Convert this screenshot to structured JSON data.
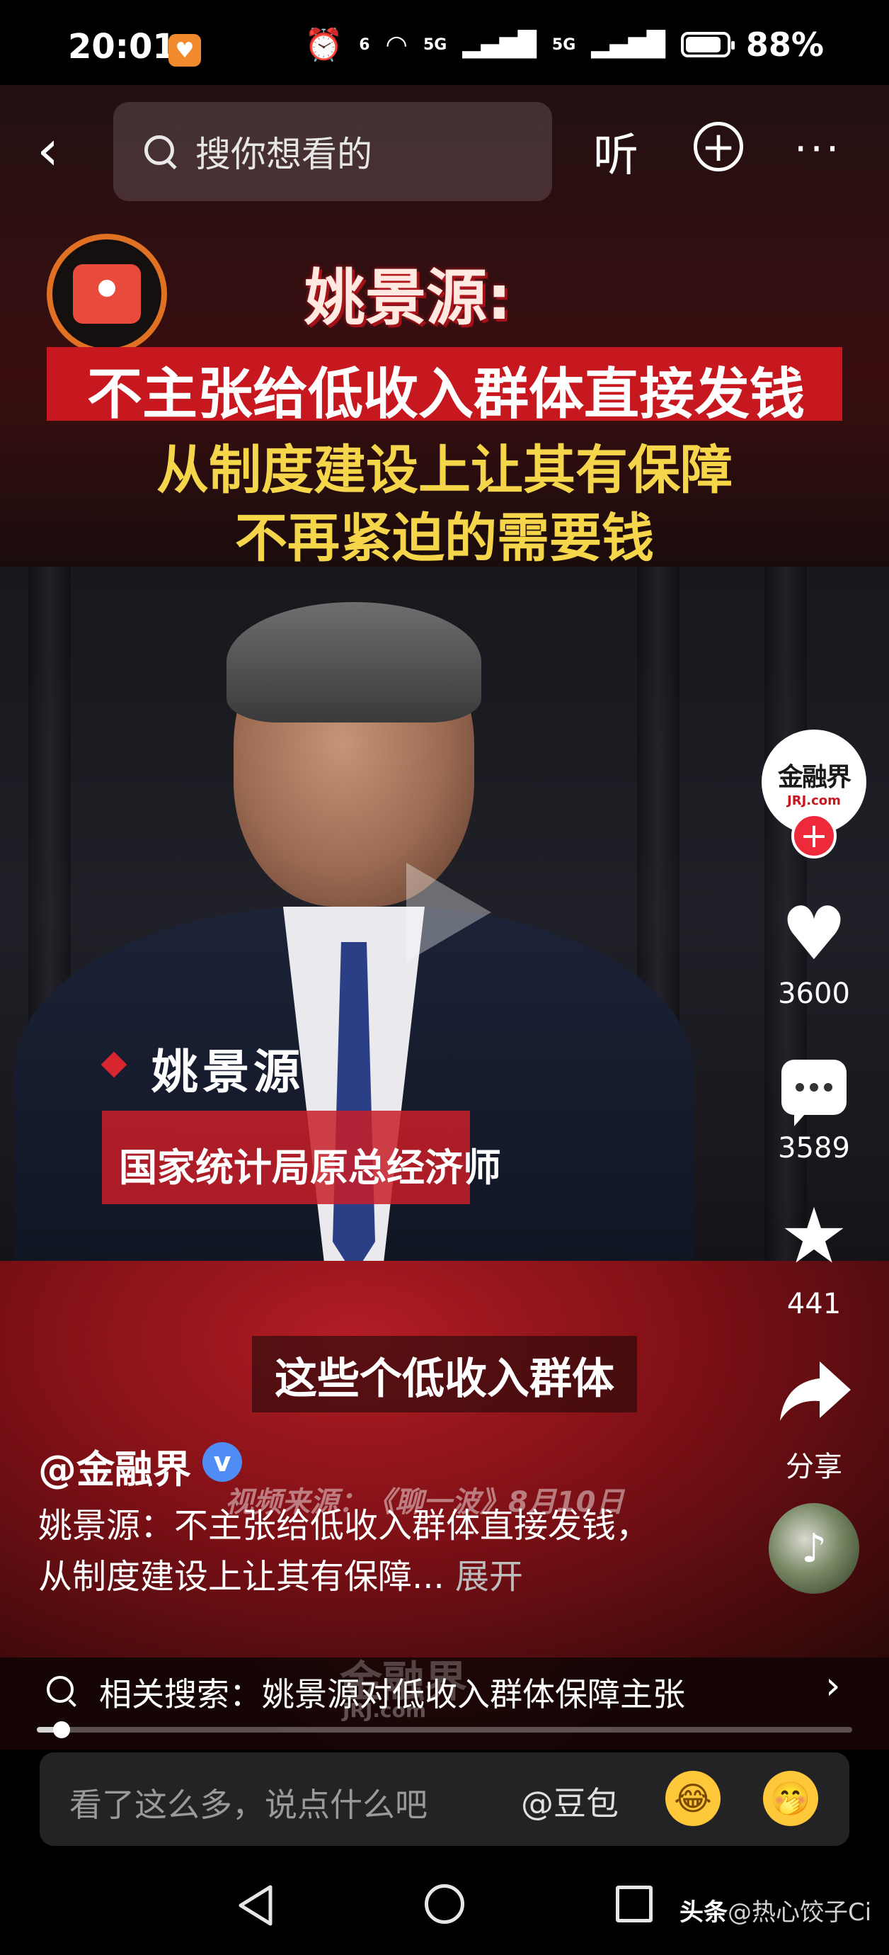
{
  "status_bar": {
    "time": "20:01",
    "signal_label_1": "5G",
    "signal_label_2": "5G",
    "wifi_label": "6",
    "battery_percent": "88%",
    "battery_level": 0.88
  },
  "top_bar": {
    "search_placeholder": "搜你想看的",
    "listen_label": "听"
  },
  "headline": {
    "name": "姚景源:",
    "line1": "不主张给低收入群体直接发钱",
    "line2": "从制度建设上让其有保障",
    "line3": "不再紧迫的需要钱"
  },
  "lower_third": {
    "speaker_name": "姚景源",
    "speaker_title": "国家统计局原总经济师"
  },
  "subtitle": "这些个低收入群体",
  "actions": {
    "author_avatar_text": "金融界",
    "author_avatar_sub": "JRJ.com",
    "like_count": "3600",
    "comment_count": "3589",
    "favorite_count": "441",
    "share_label": "分享"
  },
  "post": {
    "author_handle": "@金融界",
    "video_source": "视频来源：《聊一波》8月10日",
    "caption": "姚景源：不主张给低收入群体直接发钱，从制度建设上让其有保障...",
    "expand_label": "展开"
  },
  "related_search": {
    "text": "相关搜索：姚景源对低收入群体保障主张",
    "watermark": "金融界",
    "watermark_sub": "JRJ.com"
  },
  "progress": 0.03,
  "comment_bar": {
    "placeholder": "看了这么多，说点什么吧",
    "mention_label": "@豆包"
  },
  "credit": {
    "site": "头条",
    "author": "@热心饺子Ci"
  },
  "colors": {
    "headline_red": "#c8181f",
    "headline_yellow": "#f5d54a",
    "follow_red": "#ee2a3a",
    "verified_blue": "#4f8df5"
  }
}
